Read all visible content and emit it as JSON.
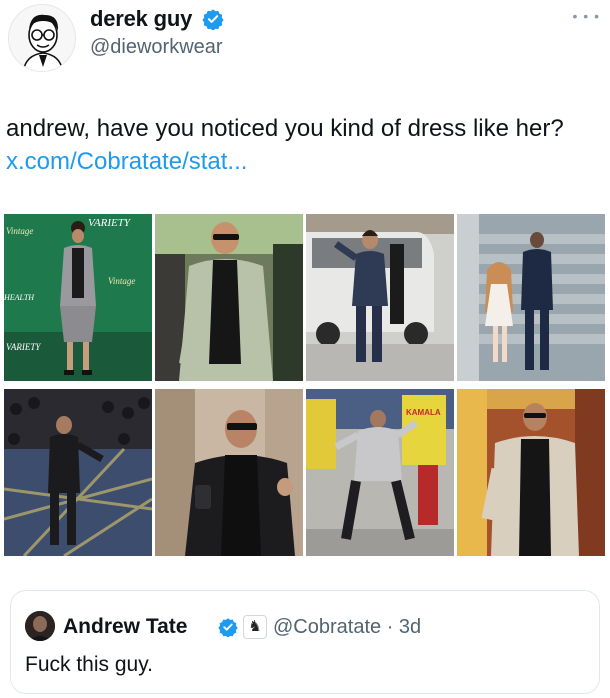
{
  "author": {
    "display_name": "derek guy",
    "handle": "@dieworkwear",
    "verified_icon": "verified-badge-icon"
  },
  "tweet": {
    "text": "andrew, have you noticed you kind of dress like her? ",
    "link_text": "x.com/Cobratate/stat..."
  },
  "media": {
    "tiles": [
      {
        "label": "photo-1",
        "logo_text": "VARIETY",
        "sign_text": "Vintage"
      },
      {
        "label": "photo-2"
      },
      {
        "label": "photo-3"
      },
      {
        "label": "photo-4"
      },
      {
        "label": "photo-5"
      },
      {
        "label": "photo-6"
      },
      {
        "label": "photo-7",
        "shirt_text": "KAMALA"
      },
      {
        "label": "photo-8"
      }
    ]
  },
  "quoted": {
    "display_name": "Andrew Tate",
    "badge_glyph": "♞",
    "handle": "@Cobratate",
    "separator": " · ",
    "time": "3d",
    "text": "Fuck this guy."
  },
  "colors": {
    "link": "#1d9bf0",
    "verified": "#1d9bf0",
    "secondary_text": "#536471"
  }
}
